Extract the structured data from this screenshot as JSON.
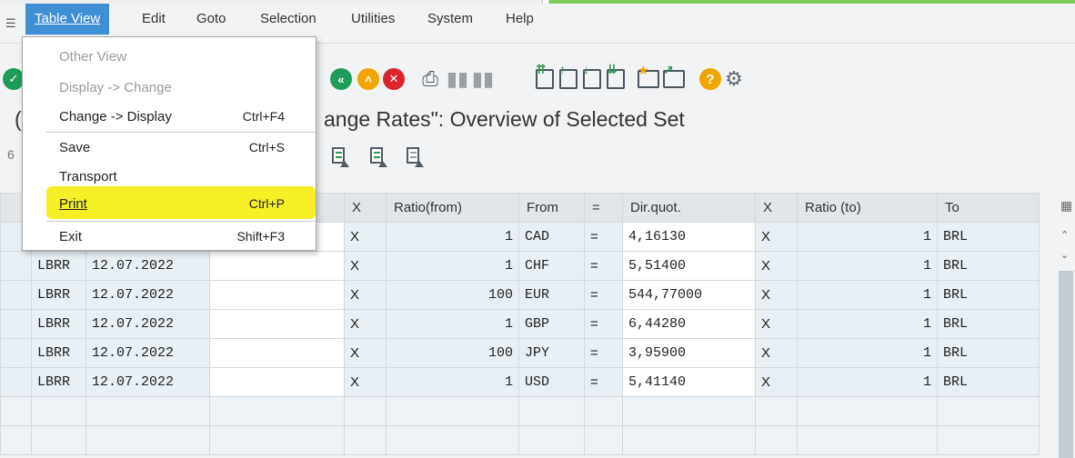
{
  "menubar": {
    "items": [
      {
        "label": "Table View"
      },
      {
        "label": "Edit"
      },
      {
        "label": "Goto"
      },
      {
        "label": "Selection"
      },
      {
        "label": "Utilities"
      },
      {
        "label": "System"
      },
      {
        "label": "Help"
      }
    ]
  },
  "dropdown": {
    "items": [
      {
        "label": "Other View",
        "shortcut": "",
        "disabled": true
      },
      {
        "label": "Display -> Change",
        "shortcut": "",
        "disabled": true
      },
      {
        "label": "Change -> Display",
        "shortcut": "Ctrl+F4",
        "disabled": false
      },
      {
        "label": "Save",
        "shortcut": "Ctrl+S",
        "disabled": false
      },
      {
        "label": "Transport",
        "shortcut": "",
        "disabled": false
      },
      {
        "label": "Print",
        "shortcut": "Ctrl+P",
        "disabled": false,
        "highlighted": true
      },
      {
        "label": "Exit",
        "shortcut": "Shift+F3",
        "disabled": false
      }
    ]
  },
  "page": {
    "title_prefix": "(",
    "title": "ange Rates\": Overview of Selected Set",
    "subbar_prefix": "6"
  },
  "table": {
    "headers": [
      "X",
      "Ratio(from)",
      "From",
      "=",
      "Dir.quot.",
      "X",
      "Ratio (to)",
      "To"
    ],
    "rows": [
      {
        "type": "",
        "date": "",
        "x1": "X",
        "ratio_from": "1",
        "from": "CAD",
        "eq": "=",
        "quot": "4,16130",
        "x2": "X",
        "ratio_to": "1",
        "to": "BRL"
      },
      {
        "type": "LBRR",
        "date": "12.07.2022",
        "x1": "X",
        "ratio_from": "1",
        "from": "CHF",
        "eq": "=",
        "quot": "5,51400",
        "x2": "X",
        "ratio_to": "1",
        "to": "BRL"
      },
      {
        "type": "LBRR",
        "date": "12.07.2022",
        "x1": "X",
        "ratio_from": "100",
        "from": "EUR",
        "eq": "=",
        "quot": "544,77000",
        "x2": "X",
        "ratio_to": "1",
        "to": "BRL"
      },
      {
        "type": "LBRR",
        "date": "12.07.2022",
        "x1": "X",
        "ratio_from": "1",
        "from": "GBP",
        "eq": "=",
        "quot": "6,44280",
        "x2": "X",
        "ratio_to": "1",
        "to": "BRL"
      },
      {
        "type": "LBRR",
        "date": "12.07.2022",
        "x1": "X",
        "ratio_from": "100",
        "from": "JPY",
        "eq": "=",
        "quot": "3,95900",
        "x2": "X",
        "ratio_to": "1",
        "to": "BRL"
      },
      {
        "type": "LBRR",
        "date": "12.07.2022",
        "x1": "X",
        "ratio_from": "1",
        "from": "USD",
        "eq": "=",
        "quot": "5,41140",
        "x2": "X",
        "ratio_to": "1",
        "to": "BRL"
      }
    ]
  },
  "colors": {
    "menu_active": "#3f8fd5",
    "highlight": "#f6ee1a",
    "status_green": "#7dcb5f"
  },
  "icons": [
    "enter-icon",
    "back-icon",
    "exit-icon",
    "cancel-icon",
    "print-icon",
    "find-icon",
    "find-next-icon",
    "first-page-icon",
    "previous-page-icon",
    "next-page-icon",
    "last-page-icon",
    "new-session-icon",
    "shortcut-icon",
    "help-icon",
    "settings-icon"
  ]
}
